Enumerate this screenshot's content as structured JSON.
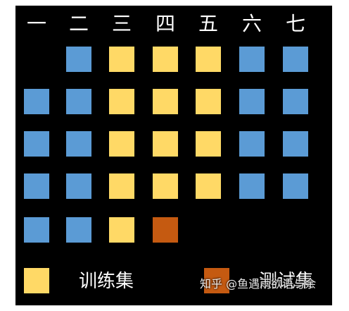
{
  "columns": [
    "一",
    "二",
    "三",
    "四",
    "五",
    "六",
    "七"
  ],
  "colors": {
    "blue": "#5b9bd5",
    "yellow": "#ffd966",
    "orange": "#c55a11",
    "background": "#000000"
  },
  "grid": [
    [
      null,
      "blue",
      "yellow",
      "yellow",
      "yellow",
      "blue",
      "blue"
    ],
    [
      "blue",
      "blue",
      "yellow",
      "yellow",
      "yellow",
      "blue",
      "blue"
    ],
    [
      "blue",
      "blue",
      "yellow",
      "yellow",
      "yellow",
      "blue",
      "blue"
    ],
    [
      "blue",
      "blue",
      "yellow",
      "yellow",
      "yellow",
      "blue",
      "blue"
    ],
    [
      "blue",
      "blue",
      "yellow",
      "orange",
      null,
      null,
      null
    ]
  ],
  "legend": {
    "train_label": "训练集",
    "test_label": "测试集",
    "train_color": "yellow",
    "test_color": "orange"
  },
  "watermark": "知乎 @鱼遇雨欲语与余"
}
